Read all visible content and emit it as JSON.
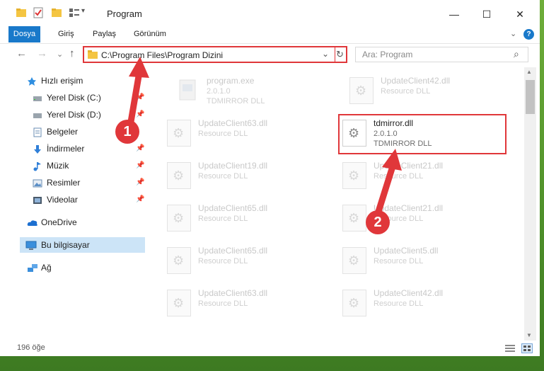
{
  "window": {
    "title": "Program",
    "minimize_glyph": "—",
    "maximize_glyph": "☐",
    "close_glyph": "✕"
  },
  "ribbon": {
    "tabs": [
      "Dosya",
      "Giriş",
      "Paylaş",
      "Görünüm"
    ],
    "expand_glyph": "⌄",
    "help_glyph": "?"
  },
  "nav": {
    "back_glyph": "←",
    "forward_glyph": "→",
    "recent_glyph": "⌄",
    "up_glyph": "↑",
    "address": "C:\\Program Files\\Program Dizini",
    "address_dropdown_glyph": "⌄",
    "refresh_glyph": "↻",
    "search_placeholder": "Ara: Program",
    "search_glyph": "⌕"
  },
  "sidebar": {
    "items": [
      {
        "label": "Hızlı erişim",
        "icon": "star-icon"
      },
      {
        "label": "Yerel Disk (C:)",
        "icon": "drive-icon"
      },
      {
        "label": "Yerel Disk (D:)",
        "icon": "drive-icon"
      },
      {
        "label": "Belgeler",
        "icon": "documents-icon"
      },
      {
        "label": "İndirmeler",
        "icon": "download-icon"
      },
      {
        "label": "Müzik",
        "icon": "music-icon"
      },
      {
        "label": "Resimler",
        "icon": "pictures-icon"
      },
      {
        "label": "Videolar",
        "icon": "video-icon"
      },
      {
        "label": "OneDrive",
        "icon": "cloud-icon"
      },
      {
        "label": "Bu bilgisayar",
        "icon": "computer-icon"
      },
      {
        "label": "Ağ",
        "icon": "network-icon"
      }
    ],
    "pin_glyph": "📌"
  },
  "files": [
    {
      "name": "program.exe",
      "desc": "2.0.1.0",
      "desc2": "TDMIRROR DLL"
    },
    {
      "name": "UpdateClient42.dll",
      "desc": "Resource DLL",
      "desc2": ""
    },
    {
      "name": "UpdateClient63.dll",
      "desc": "Resource DLL",
      "desc2": ""
    },
    {
      "name": "tdmirror.dll",
      "desc": "2.0.1.0",
      "desc2": "TDMIRROR DLL"
    },
    {
      "name": "UpdateClient19.dll",
      "desc": "Resource DLL",
      "desc2": ""
    },
    {
      "name": "UpdateClient21.dll",
      "desc": "Resource DLL",
      "desc2": ""
    },
    {
      "name": "UpdateClient65.dll",
      "desc": "Resource DLL",
      "desc2": ""
    },
    {
      "name": "UpdateClient21.dll",
      "desc": "Resource DLL",
      "desc2": ""
    },
    {
      "name": "UpdateClient65.dll",
      "desc": "Resource DLL",
      "desc2": ""
    },
    {
      "name": "UpdateClient5.dll",
      "desc": "Resource DLL",
      "desc2": ""
    },
    {
      "name": "UpdateClient63.dll",
      "desc": "Resource DLL",
      "desc2": ""
    },
    {
      "name": "UpdateClient42.dll",
      "desc": "Resource DLL",
      "desc2": ""
    }
  ],
  "status": {
    "count": "196 öğe"
  },
  "annotations": {
    "step1": "1",
    "step2": "2",
    "color": "#e0373a"
  }
}
